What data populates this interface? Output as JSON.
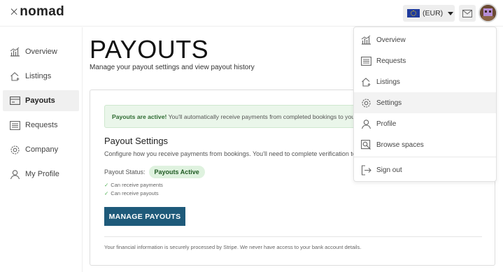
{
  "header": {
    "logo_mark": "×",
    "logo_word": "nomad",
    "currency_label": "(EUR)"
  },
  "sidebar": {
    "items": [
      {
        "label": "Overview",
        "icon": "chart-icon"
      },
      {
        "label": "Listings",
        "icon": "house-plus-icon"
      },
      {
        "label": "Payouts",
        "icon": "card-icon",
        "active": true
      },
      {
        "label": "Requests",
        "icon": "list-icon"
      },
      {
        "label": "Company",
        "icon": "gear-icon"
      },
      {
        "label": "My Profile",
        "icon": "person-icon"
      }
    ]
  },
  "main": {
    "title": "PAYOUTS",
    "subtitle": "Manage your payout settings and view payout history",
    "notice_strong": "Payouts are active!",
    "notice_text": " You'll automatically receive payments from completed bookings to your bank account.",
    "settings_title": "Payout Settings",
    "settings_desc": "Configure how you receive payments from bookings. You'll need to complete verification to receive payouts.",
    "status_label": "Payout Status:",
    "status_value": "Payouts Active",
    "checks": [
      "Can receive payments",
      "Can receive payouts"
    ],
    "manage_button": "MANAGE PAYOUTS",
    "footnote": "Your financial information is securely processed by Stripe. We never have access to your bank account details."
  },
  "dropdown": {
    "items": [
      {
        "label": "Overview",
        "icon": "chart-icon"
      },
      {
        "label": "Requests",
        "icon": "list-icon"
      },
      {
        "label": "Listings",
        "icon": "house-plus-icon"
      },
      {
        "label": "Settings",
        "icon": "gear-icon",
        "hover": true
      },
      {
        "label": "Profile",
        "icon": "person-icon"
      },
      {
        "label": "Browse spaces",
        "icon": "search-icon"
      },
      {
        "label": "Sign out",
        "icon": "sign-out-icon"
      }
    ]
  },
  "colors": {
    "accent": "#1e5a7a",
    "success_bg": "#eaf6ea",
    "success_text": "#2d6a31",
    "active_bg": "#f0f0f0"
  }
}
